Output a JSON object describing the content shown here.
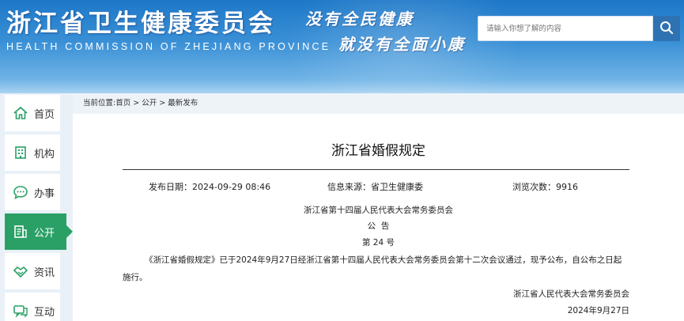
{
  "header": {
    "title": "浙江省卫生健康委员会",
    "subtitle": "HEALTH COMMISSION OF ZHEJIANG PROVINCE",
    "slogan_line1": "没有全民健康",
    "slogan_line2": "就没有全面小康",
    "search": {
      "placeholder": "请输入你想了解的内容"
    }
  },
  "sidebar": {
    "items": [
      {
        "label": "首页",
        "icon": "home-icon"
      },
      {
        "label": "机构",
        "icon": "building-icon"
      },
      {
        "label": "办事",
        "icon": "chat-icon"
      },
      {
        "label": "公开",
        "icon": "document-icon",
        "active": true
      },
      {
        "label": "资讯",
        "icon": "handshake-icon"
      },
      {
        "label": "互动",
        "icon": "comment-icon"
      }
    ]
  },
  "breadcrumb": {
    "prefix": "当前位置:",
    "items": [
      "首页",
      "公开",
      "最新发布"
    ],
    "separator": " > "
  },
  "article": {
    "title": "浙江省婚假规定",
    "meta": {
      "date_label": "发布日期：",
      "date": "2024-09-29 08:46",
      "source_label": "信息来源：",
      "source": "省卫生健康委",
      "views_label": "浏览次数：",
      "views": "9916"
    },
    "body": {
      "issuer": "浙江省第十四届人民代表大会常务委员会",
      "notice": "公  告",
      "number": "第 24 号",
      "paragraph_line1": "《浙江省婚假规定》已于2024年9月27日经浙江省第十四届人民代表大会常务委员会第十二次会议通过，现予公布，自公布之日起",
      "paragraph_line2": "施行。",
      "signature": "浙江省人民代表大会常务委员会",
      "sign_date": "2024年9月27日"
    }
  }
}
